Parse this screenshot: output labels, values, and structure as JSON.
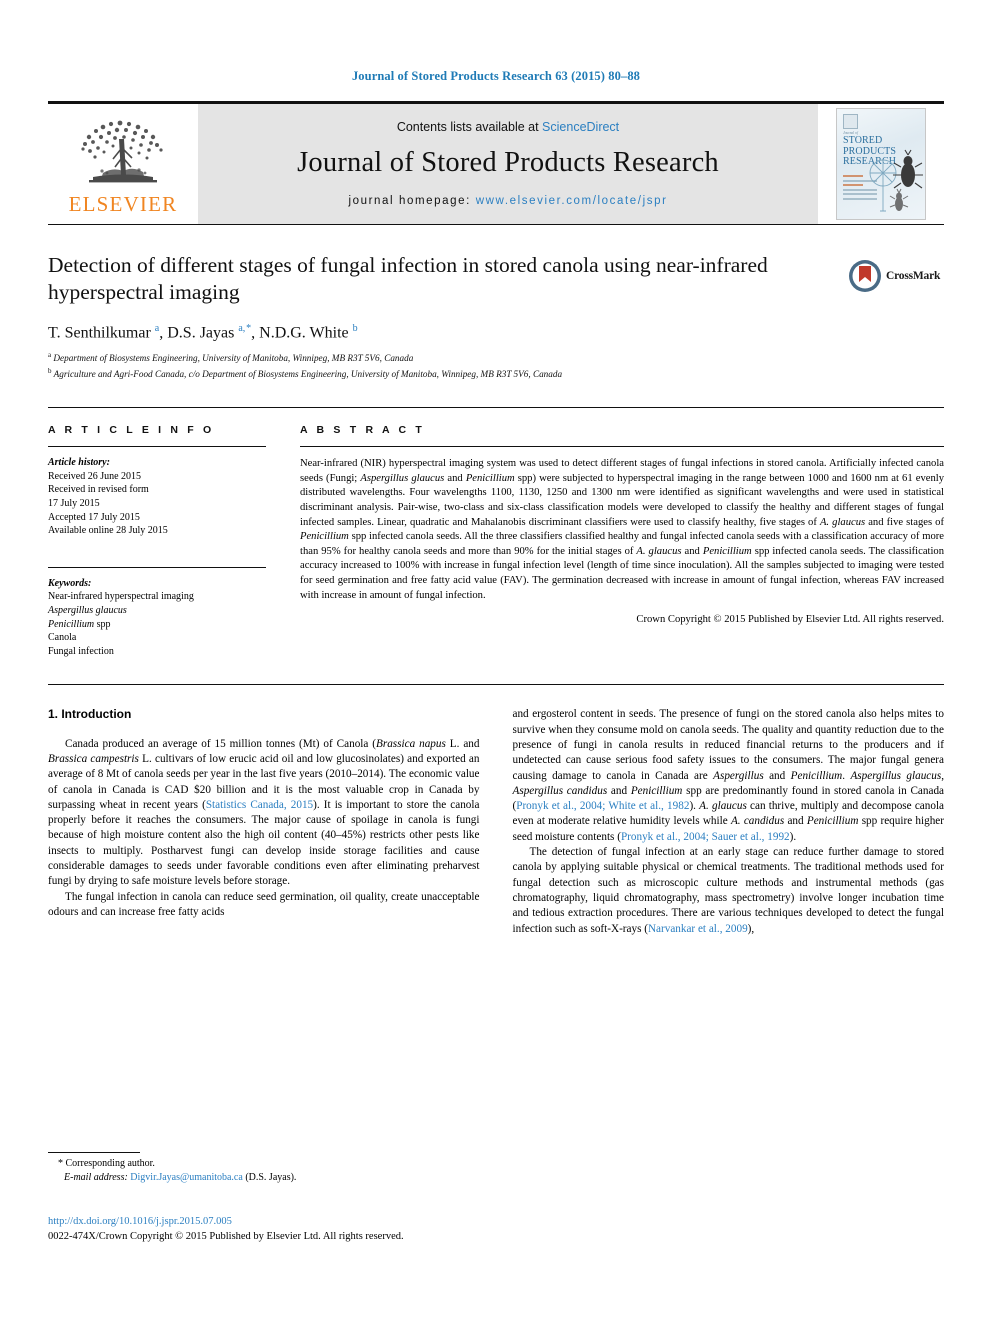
{
  "running_head": "Journal of Stored Products Research 63 (2015) 80–88",
  "masthead": {
    "publisher_name": "ELSEVIER",
    "contents_prefix": "Contents lists available at ",
    "contents_link": "ScienceDirect",
    "journal_name": "Journal of Stored Products Research",
    "homepage_prefix": "journal homepage: ",
    "homepage_url": "www.elsevier.com/locate/jspr",
    "cover": {
      "sub": "Journal of",
      "line1": "STORED",
      "line2": "PRODUCTS",
      "line3": "RESEARCH"
    }
  },
  "article": {
    "title": "Detection of different stages of fungal infection in stored canola using near-infrared hyperspectral imaging",
    "crossmark_label": "CrossMark",
    "authors_html": "T. Senthilkumar <sup>a</sup>, D.S. Jayas <sup>a, *</sup>, N.D.G. White <sup>b</sup>",
    "affiliations": [
      "Department of Biosystems Engineering, University of Manitoba, Winnipeg, MB R3T 5V6, Canada",
      "Agriculture and Agri-Food Canada, c/o Department of Biosystems Engineering, University of Manitoba, Winnipeg, MB R3T 5V6, Canada"
    ]
  },
  "article_info": {
    "heading": "A R T I C L E   I N F O",
    "history_label": "Article history:",
    "history": [
      "Received 26 June 2015",
      "Received in revised form",
      "17 July 2015",
      "Accepted 17 July 2015",
      "Available online 28 July 2015"
    ],
    "keywords_label": "Keywords:",
    "keywords": [
      "Near-infrared hyperspectral imaging",
      "Aspergillus glaucus",
      "Penicillium spp",
      "Canola",
      "Fungal infection"
    ]
  },
  "abstract": {
    "heading": "A B S T R A C T",
    "text": "Near-infrared (NIR) hyperspectral imaging system was used to detect different stages of fungal infections in stored canola. Artificially infected canola seeds (Fungi; Aspergillus glaucus and Penicillium spp) were subjected to hyperspectral imaging in the range between 1000 and 1600 nm at 61 evenly distributed wavelengths. Four wavelengths 1100, 1130, 1250 and 1300 nm were identified as significant wavelengths and were used in statistical discriminant analysis. Pair-wise, two-class and six-class classification models were developed to classify the healthy and different stages of fungal infected samples. Linear, quadratic and Mahalanobis discriminant classifiers were used to classify healthy, five stages of A. glaucus and five stages of Penicillium spp infected canola seeds. All the three classifiers classified healthy and fungal infected canola seeds with a classification accuracy of more than 95% for healthy canola seeds and more than 90% for the initial stages of A. glaucus and Penicillium spp infected canola seeds. The classification accuracy increased to 100% with increase in fungal infection level (length of time since inoculation). All the samples subjected to imaging were tested for seed germination and free fatty acid value (FAV). The germination decreased with increase in amount of fungal infection, whereas FAV increased with increase in amount of fungal infection.",
    "copyright": "Crown Copyright © 2015 Published by Elsevier Ltd. All rights reserved."
  },
  "introduction": {
    "heading": "1. Introduction",
    "left_paragraph_1": "Canada produced an average of 15 million tonnes (Mt) of Canola (Brassica napus L. and Brassica campestris L. cultivars of low erucic acid oil and low glucosinolates) and exported an average of 8 Mt of canola seeds per year in the last five years (2010–2014). The economic value of canola in Canada is CAD $20 billion and it is the most valuable crop in Canada by surpassing wheat in recent years (Statistics Canada, 2015). It is important to store the canola properly before it reaches the consumers. The major cause of spoilage in canola is fungi because of high moisture content also the high oil content (40–45%) restricts other pests like insects to multiply. Postharvest fungi can develop inside storage facilities and cause considerable damages to seeds under favorable conditions even after eliminating preharvest fungi by drying to safe moisture levels before storage.",
    "left_paragraph_2": "The fungal infection in canola can reduce seed germination, oil quality, create unacceptable odours and can increase free fatty acids",
    "right_paragraph_1": "and ergosterol content in seeds. The presence of fungi on the stored canola also helps mites to survive when they consume mold on canola seeds. The quality and quantity reduction due to the presence of fungi in canola results in reduced financial returns to the producers and if undetected can cause serious food safety issues to the consumers. The major fungal genera causing damage to canola in Canada are Aspergillus and Penicillium. Aspergillus glaucus, Aspergillus candidus and Penicillium spp are predominantly found in stored canola in Canada (Pronyk et al., 2004; White et al., 1982). A. glaucus can thrive, multiply and decompose canola even at moderate relative humidity levels while A. candidus and Penicillium spp require higher seed moisture contents (Pronyk et al., 2004; Sauer et al., 1992).",
    "right_paragraph_2": "The detection of fungal infection at an early stage can reduce further damage to stored canola by applying suitable physical or chemical treatments. The traditional methods used for fungal detection such as microscopic culture methods and instrumental methods (gas chromatography, liquid chromatography, mass spectrometry) involve longer incubation time and tedious extraction procedures. There are various techniques developed to detect the fungal infection such as soft-X-rays (Narvankar et al., 2009),",
    "citations": [
      "Statistics Canada, 2015",
      "Pronyk et al., 2004; White et al., 1982",
      "Pronyk et al., 2004; Sauer et al., 1992",
      "Narvankar et al., 2009"
    ]
  },
  "footnote": {
    "corresponding": "* Corresponding author.",
    "email_label": "E-mail address:",
    "email": "Digvir.Jayas@umanitoba.ca",
    "email_suffix": "(D.S. Jayas)."
  },
  "footer": {
    "doi": "http://dx.doi.org/10.1016/j.jspr.2015.07.005",
    "issn_line": "0022-474X/Crown Copyright © 2015 Published by Elsevier Ltd. All rights reserved."
  },
  "colors": {
    "link_blue": "#2b7fc1",
    "elsevier_orange": "#f08521",
    "masthead_gray": "#e4e4e4"
  }
}
